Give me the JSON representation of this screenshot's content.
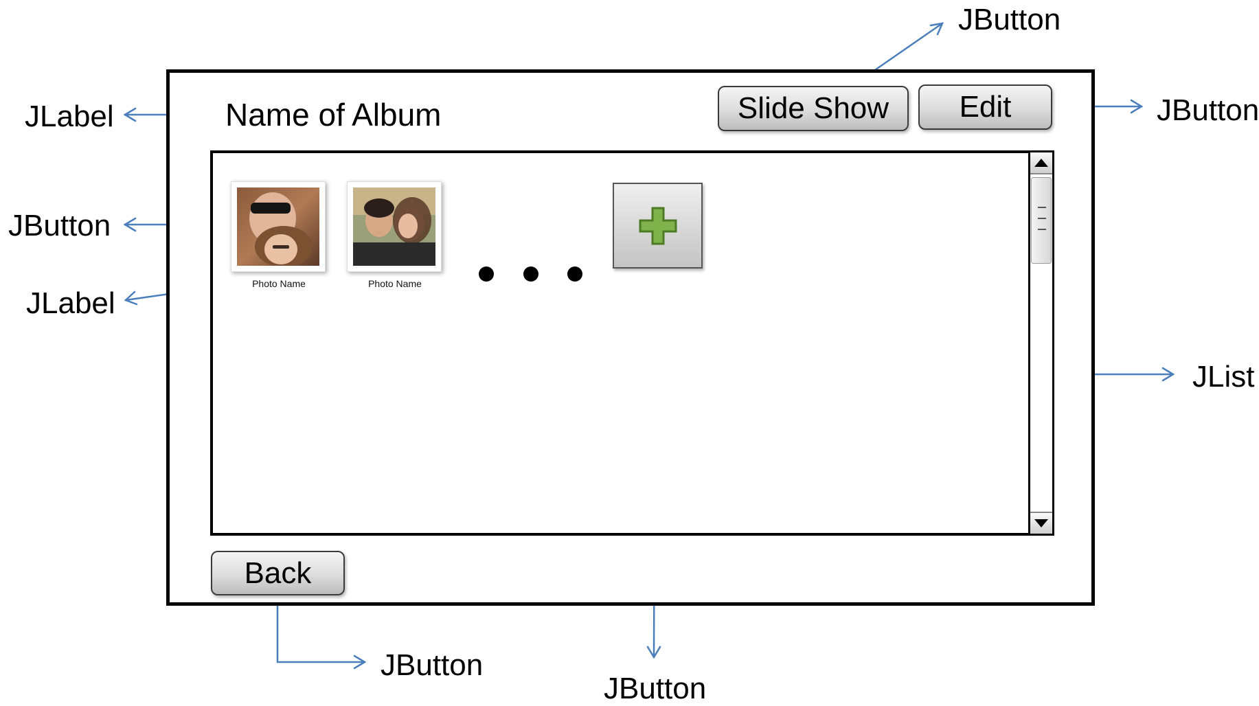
{
  "window": {
    "album_title": "Name of Album",
    "slideshow_label": "Slide Show",
    "edit_label": "Edit",
    "back_label": "Back"
  },
  "photos": [
    {
      "label": "Photo Name"
    },
    {
      "label": "Photo Name"
    }
  ],
  "annotations": {
    "album_title_type": "JLabel",
    "slideshow_type": "JButton",
    "edit_type": "JButton",
    "photo_button_type": "JButton",
    "photo_label_type": "JLabel",
    "list_type": "JList",
    "back_type": "JButton",
    "add_type": "JButton"
  },
  "colors": {
    "arrow": "#4a7ebb",
    "plus_fill": "#7fb24a",
    "plus_stroke": "#4d7a25"
  },
  "icons": {
    "add": "plus-icon",
    "scroll_up": "triangle-up-icon",
    "scroll_down": "triangle-down-icon"
  }
}
